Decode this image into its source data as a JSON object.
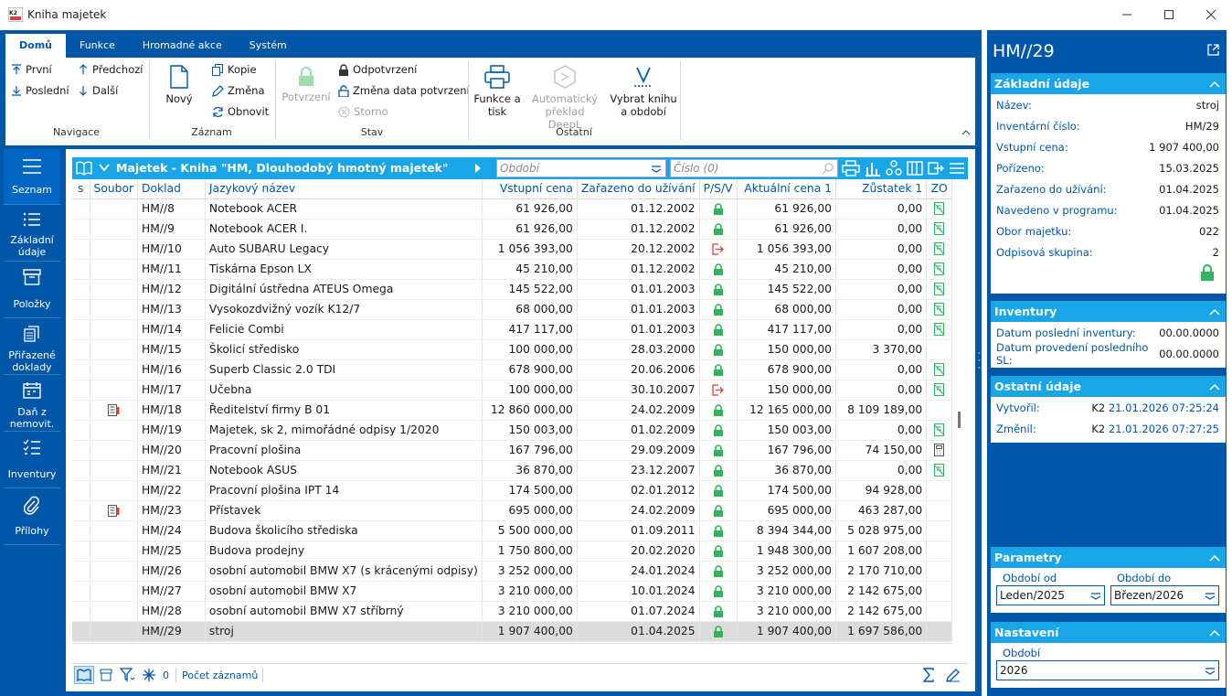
{
  "window": {
    "title": "Kniha majetek"
  },
  "ribbon": {
    "tabs": [
      "Domů",
      "Funkce",
      "Hromadné akce",
      "Systém"
    ],
    "navigation": {
      "first": "První",
      "last": "Poslední",
      "prev": "Předchozí",
      "next": "Další",
      "label": "Navigace"
    },
    "record": {
      "new": "Nový",
      "copy": "Kopie",
      "edit": "Změna",
      "refresh": "Obnovit",
      "label": "Záznam"
    },
    "state": {
      "confirm": "Potvrzení",
      "unconfirm": "Odpotvrzení",
      "change_date": "Změna data potvrzení",
      "cancel": "Storno",
      "label": "Stav"
    },
    "other": {
      "print": "Funkce a tisk",
      "translate": "Automatický překlad DeepL",
      "choose_book": "Vybrat knihu a období",
      "label": "Ostatní"
    }
  },
  "sidebar": {
    "items": [
      {
        "label": "Seznam",
        "icon": "list-lines-icon"
      },
      {
        "label": "Základní údaje",
        "icon": "bulleted-list-icon"
      },
      {
        "label": "Položky",
        "icon": "box-icon"
      },
      {
        "label": "Přiřazené doklady",
        "icon": "documents-icon"
      },
      {
        "label": "Daň z nemovit.",
        "icon": "calendar-icon"
      },
      {
        "label": "Inventury",
        "icon": "checklist-icon"
      },
      {
        "label": "Přílohy",
        "icon": "paperclip-icon"
      }
    ]
  },
  "grid": {
    "title": "Majetek - Kniha \"HM, Dlouhodobý hmotný majetek\"",
    "filter_period_placeholder": "Období",
    "filter_number_placeholder": "Číslo (0)",
    "columns": [
      "s",
      "Soubor",
      "Doklad",
      "Jazykový název",
      "Vstupní cena",
      "Zařazeno do užívání",
      "P/S/V",
      "Aktuální cena 1",
      "Zůstatek 1",
      "ZO"
    ],
    "rows": [
      {
        "file": "",
        "doc": "HM//8",
        "name": "Notebook ACER",
        "price": "61 926,00",
        "date": "01.12.2002",
        "psv": "lock",
        "cur": "61 926,00",
        "bal": "0,00",
        "zo": "noedit"
      },
      {
        "file": "",
        "doc": "HM//9",
        "name": "Notebook ACER I.",
        "price": "61 926,00",
        "date": "01.12.2002",
        "psv": "lock",
        "cur": "61 926,00",
        "bal": "0,00",
        "zo": "noedit"
      },
      {
        "file": "",
        "doc": "HM//10",
        "name": "Auto SUBARU Legacy",
        "price": "1 056 393,00",
        "date": "20.12.2002",
        "psv": "exit",
        "cur": "1 056 393,00",
        "bal": "0,00",
        "zo": "noedit"
      },
      {
        "file": "",
        "doc": "HM//11",
        "name": "Tiskárna Epson LX",
        "price": "45 210,00",
        "date": "01.12.2002",
        "psv": "lock",
        "cur": "45 210,00",
        "bal": "0,00",
        "zo": "noedit"
      },
      {
        "file": "",
        "doc": "HM//12",
        "name": "Digitální ústředna ATEUS Omega",
        "price": "145 522,00",
        "date": "01.01.2003",
        "psv": "lock",
        "cur": "145 522,00",
        "bal": "0,00",
        "zo": "noedit"
      },
      {
        "file": "",
        "doc": "HM//13",
        "name": "Vysokozdvižný vozík K12/7",
        "price": "68 000,00",
        "date": "01.01.2003",
        "psv": "lock",
        "cur": "68 000,00",
        "bal": "0,00",
        "zo": "noedit"
      },
      {
        "file": "",
        "doc": "HM//14",
        "name": "Felicie Combi",
        "price": "417 117,00",
        "date": "01.01.2003",
        "psv": "lock",
        "cur": "417 117,00",
        "bal": "0,00",
        "zo": "noedit"
      },
      {
        "file": "",
        "doc": "HM//15",
        "name": "Školicí středisko",
        "price": "100 000,00",
        "date": "28.03.2000",
        "psv": "lock",
        "cur": "150 000,00",
        "bal": "3 370,00",
        "zo": ""
      },
      {
        "file": "",
        "doc": "HM//16",
        "name": "Superb Classic  2.0 TDI",
        "price": "678 900,00",
        "date": "20.06.2006",
        "psv": "lock",
        "cur": "678 900,00",
        "bal": "0,00",
        "zo": "noedit"
      },
      {
        "file": "",
        "doc": "HM//17",
        "name": "Učebna",
        "price": "100 000,00",
        "date": "30.10.2007",
        "psv": "exit",
        "cur": "150 000,00",
        "bal": "0,00",
        "zo": "noedit"
      },
      {
        "file": "doc",
        "doc": "HM//18",
        "name": "Ředitelství firmy B 01",
        "price": "12 860 000,00",
        "date": "24.02.2009",
        "psv": "lock",
        "cur": "12 165 000,00",
        "bal": "8 109 189,00",
        "zo": ""
      },
      {
        "file": "",
        "doc": "HM//19",
        "name": "Majetek, sk 2, mimořádné odpisy 1/2020",
        "price": "150 003,00",
        "date": "01.02.2009",
        "psv": "lock",
        "cur": "150 003,00",
        "bal": "0,00",
        "zo": "noedit"
      },
      {
        "file": "",
        "doc": "HM//20",
        "name": "Pracovní plošina",
        "price": "167 796,00",
        "date": "29.09.2009",
        "psv": "lock",
        "cur": "167 796,00",
        "bal": "74 150,00",
        "zo": "calc"
      },
      {
        "file": "",
        "doc": "HM//21",
        "name": "Notebook ASUS",
        "price": "36 870,00",
        "date": "23.12.2007",
        "psv": "lock",
        "cur": "36 870,00",
        "bal": "0,00",
        "zo": "noedit"
      },
      {
        "file": "",
        "doc": "HM//22",
        "name": "Pracovní plošina IPT 14",
        "price": "174 500,00",
        "date": "02.01.2012",
        "psv": "lock",
        "cur": "174 500,00",
        "bal": "94 928,00",
        "zo": ""
      },
      {
        "file": "doc",
        "doc": "HM//23",
        "name": "Přístavek",
        "price": "695 000,00",
        "date": "24.02.2009",
        "psv": "lock",
        "cur": "695 000,00",
        "bal": "463 287,00",
        "zo": ""
      },
      {
        "file": "",
        "doc": "HM//24",
        "name": "Budova školicího střediska",
        "price": "5 500 000,00",
        "date": "01.09.2011",
        "psv": "lock",
        "cur": "8 394 344,00",
        "bal": "5 028 975,00",
        "zo": ""
      },
      {
        "file": "",
        "doc": "HM//25",
        "name": "Budova prodejny",
        "price": "1 750 800,00",
        "date": "20.02.2020",
        "psv": "lock",
        "cur": "1 948 300,00",
        "bal": "1 607 208,00",
        "zo": ""
      },
      {
        "file": "",
        "doc": "HM//26",
        "name": "osobní automobil BMW X7 (s krácenými odpisy)",
        "price": "3 252 000,00",
        "date": "24.01.2024",
        "psv": "lock",
        "cur": "3 252 000,00",
        "bal": "2 170 710,00",
        "zo": ""
      },
      {
        "file": "",
        "doc": "HM//27",
        "name": "osobní automobil BMW X7",
        "price": "3 210 000,00",
        "date": "10.01.2024",
        "psv": "lock",
        "cur": "3 210 000,00",
        "bal": "2 142 675,00",
        "zo": ""
      },
      {
        "file": "",
        "doc": "HM//28",
        "name": "osobní automobil BMW X7 stříbrný",
        "price": "3 210 000,00",
        "date": "01.07.2024",
        "psv": "lock",
        "cur": "3 210 000,00",
        "bal": "2 142 675,00",
        "zo": ""
      },
      {
        "file": "",
        "doc": "HM//29",
        "name": "stroj",
        "price": "1 907 400,00",
        "date": "01.04.2025",
        "psv": "lock",
        "cur": "1 907 400,00",
        "bal": "1 697 586,00",
        "zo": "",
        "selected": true
      }
    ],
    "footer": {
      "count": "0",
      "records_label": "Počet záznamů"
    }
  },
  "detail": {
    "title": "HM//29",
    "basic": {
      "label": "Základní údaje",
      "fields": [
        {
          "k": "Název:",
          "v": "stroj"
        },
        {
          "k": "Inventární číslo:",
          "v": "HM/29"
        },
        {
          "k": "Vstupní cena:",
          "v": "1 907 400,00"
        },
        {
          "k": "Pořízeno:",
          "v": "15.03.2025"
        },
        {
          "k": "Zařazeno do užívání:",
          "v": "01.04.2025"
        },
        {
          "k": "Navedeno v programu:",
          "v": "01.04.2025"
        },
        {
          "k": "Obor majetku:",
          "v": "022"
        },
        {
          "k": "Odpisová skupina:",
          "v": "2"
        }
      ]
    },
    "inventory": {
      "label": "Inventury",
      "fields": [
        {
          "k": "Datum poslední inventury:",
          "v": "00.00.0000"
        },
        {
          "k": "Datum provedení posledního SL:",
          "v": "00.00.0000"
        }
      ]
    },
    "other": {
      "label": "Ostatní údaje",
      "created_label": "Vytvořil:",
      "created_user": "K2",
      "created_at": "21.01.2026 07:25:24",
      "changed_label": "Změnil:",
      "changed_user": "K2",
      "changed_at": "21.01.2026 07:27:25"
    },
    "params": {
      "label": "Parametry",
      "from_label": "Období od",
      "from_value": "Leden/2025",
      "to_label": "Období do",
      "to_value": "Březen/2026"
    },
    "settings": {
      "label": "Nastavení",
      "period_label": "Období",
      "period_value": "2026"
    }
  },
  "colors": {
    "brand": "#0057a8",
    "accent": "#19a5e6",
    "lock": "#2fb55a",
    "exit": "#d0423b"
  }
}
